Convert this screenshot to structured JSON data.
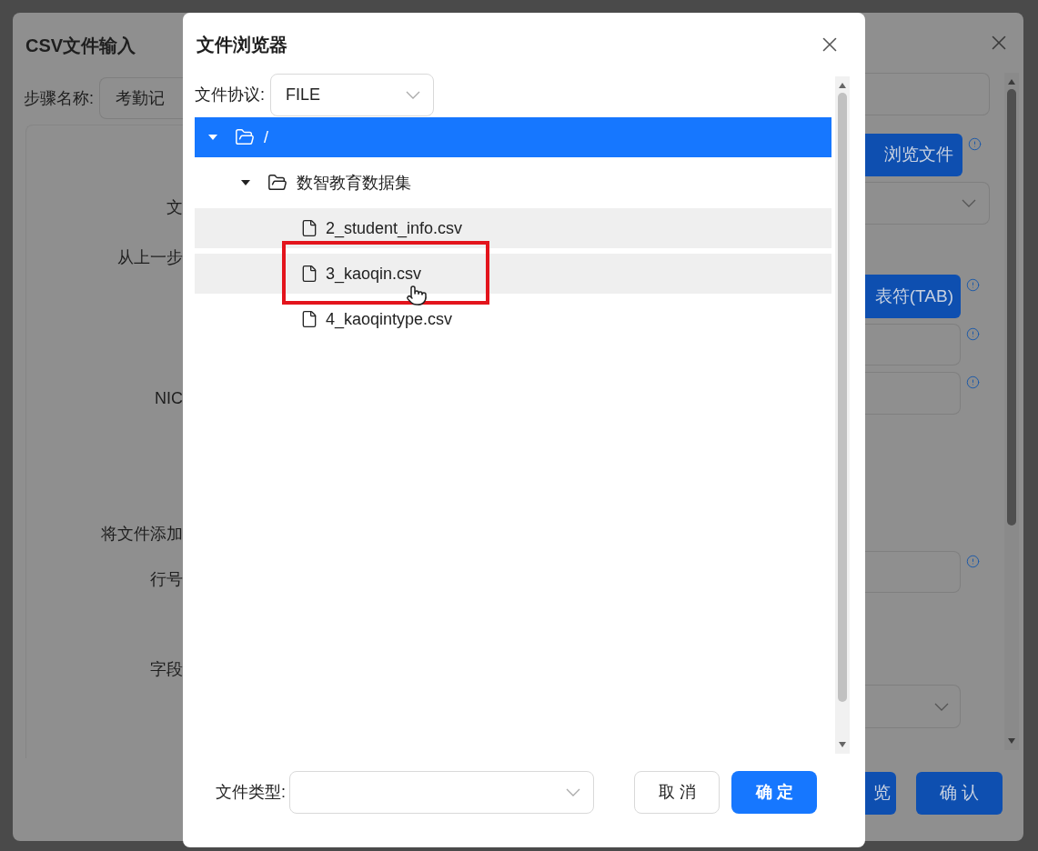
{
  "background_dialog": {
    "title": "CSV文件输入",
    "step_name": {
      "label": "步骤名称:",
      "value": "考勤记"
    },
    "labels": [
      "文",
      "从上一步",
      "NIC",
      "将文件添加",
      "行号",
      "字段"
    ],
    "browse_button": "浏览文件",
    "delimiter_button": "表符(TAB)",
    "preview_button": "览",
    "confirm_button": "确 认"
  },
  "file_browser": {
    "title": "文件浏览器",
    "protocol": {
      "label": "文件协议:",
      "value": "FILE"
    },
    "tree": [
      {
        "name": "/",
        "kind": "folder",
        "expanded": true,
        "selected": true,
        "children": [
          {
            "name": "数智教育数据集",
            "kind": "folder",
            "expanded": true,
            "selected": false,
            "shaded": false,
            "children": [
              {
                "name": "2_student_info.csv",
                "kind": "file",
                "selected": false,
                "shaded": true
              },
              {
                "name": "3_kaoqin.csv",
                "kind": "file",
                "selected": false,
                "shaded": true,
                "annotated": true
              },
              {
                "name": "4_kaoqintype.csv",
                "kind": "file",
                "selected": false,
                "shaded": false
              }
            ]
          }
        ]
      }
    ],
    "file_type": {
      "label": "文件类型:"
    },
    "cancel_button": "取 消",
    "ok_button": "确 定"
  }
}
